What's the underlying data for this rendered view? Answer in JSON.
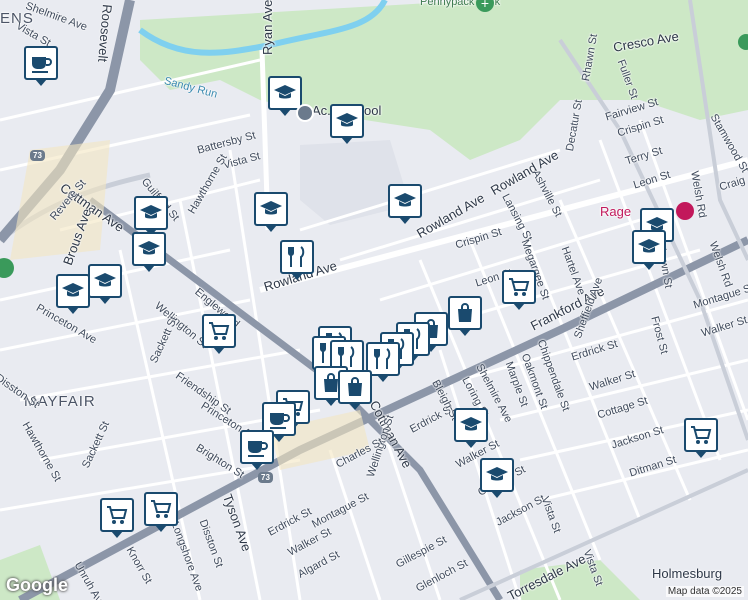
{
  "map": {
    "neighborhoods": {
      "mayfair": "MAYFAIR",
      "holmesburg": "Holmesburg",
      "ens_fragment": "ENS"
    },
    "parks": {
      "pennypack": "Pennypack Park"
    },
    "water": {
      "sandy_run": "Sandy Run"
    },
    "poi": {
      "rage": "Rage",
      "school": "Ac... School"
    },
    "route": "73",
    "streets": {
      "rowland_ave": "Rowland Ave",
      "cottman_ave": "Cottman Ave",
      "frankford_ave": "Frankford Ave",
      "roosevelt": "Roosevelt",
      "ryan_ave": "Ryan Ave",
      "cresco_ave": "Cresco Ave",
      "battersby_st": "Battersby St",
      "vista_st": "Vista St",
      "guilford_st": "Guilford St",
      "hawthorne_st": "Hawthorne St",
      "revere_st": "Revere St",
      "brous_ave": "Brous Ave",
      "princeton_ave": "Princeton Ave",
      "wellington_st": "Wellington St",
      "englewood": "Englewood",
      "sackett_st": "Sackett St",
      "friendship_st": "Friendship St",
      "disston_st": "Disston St",
      "brighton_st": "Brighton St",
      "crispin_st": "Crispin St",
      "leon_st": "Leon St",
      "lansing_st": "Lansing St",
      "ashville_st": "Ashville St",
      "decatur_st": "Decatur St",
      "rhawn_st": "Rhawn St",
      "fuller_st": "Fuller St",
      "fairview_st": "Fairview St",
      "terry_st": "Terry St",
      "hartel_ave": "Hartel Ave",
      "megargee_st": "Megargee St",
      "erdrick_st": "Erdrick St",
      "walker_st": "Walker St",
      "cottage_st": "Cottage St",
      "jackson_st": "Jackson St",
      "ditman_st": "Ditman St",
      "montague_st": "Montague St",
      "frost_st": "Frost St",
      "welsh_rd": "Welsh Rd",
      "stamwood_st": "Stamwood St",
      "sheffield_ave": "Sheffield Ave",
      "chippendale_st": "Chippendale St",
      "oakmont_st": "Oakmont St",
      "marple_st": "Marple St",
      "shelmire_ave": "Shelmire Ave",
      "loring_st": "Loring St",
      "bleigh_st": "Bleigh St",
      "charles_st": "Charles St",
      "tyson_ave": "Tyson Ave",
      "longshore_ave": "Longshore Ave",
      "knorr_st": "Knorr St",
      "unruh_ave": "Unruh Ave",
      "gillespie_st": "Gillespie St",
      "glenloch_st": "Glenloch St",
      "torresdale_ave": "Torresdale Ave",
      "algard_st": "Algard St",
      "shelmire_nw": "Shelmire Ave",
      "craig": "Craig",
      "vista_se": "Vista St"
    },
    "attribution": "Map data ©2025",
    "google": "Google"
  }
}
